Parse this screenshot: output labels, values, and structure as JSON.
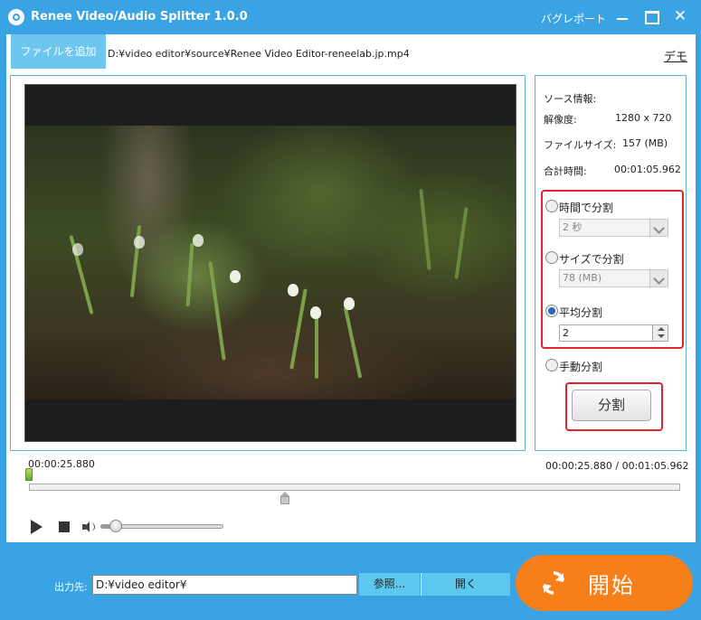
{
  "window": {
    "title": "Renee Video/Audio Splitter 1.0.0",
    "bug_report": "バグレポート",
    "close_glyph": "✕"
  },
  "toolbar": {
    "add_file": "ファイルを追加",
    "file_path": "D:¥video editor¥source¥Renee Video Editor-reneelab.jp.mp4",
    "demo": "デモ"
  },
  "source_info": {
    "header": "ソース情報:",
    "resolution_label": "解像度:",
    "resolution_value": "1280 x 720",
    "filesize_label": "ファイルサイズ:",
    "filesize_value": "157 (MB)",
    "duration_label": "合計時間:",
    "duration_value": "00:01:05.962"
  },
  "split_options": {
    "by_time_label": "時間で分割",
    "by_time_value": "2 秒",
    "by_size_label": "サイズで分割",
    "by_size_value": "78 (MB)",
    "even_label": "平均分割",
    "even_value": "2",
    "manual_label": "手動分割",
    "selected": "even"
  },
  "split_button": "分割",
  "timeline": {
    "current_time": "00:00:25.880",
    "position_display": "00:00:25.880 / 00:01:05.962",
    "progress": 0.3924
  },
  "volume": {
    "level": 0.1
  },
  "footer": {
    "output_label": "出力先:",
    "output_path": "D:¥video editor¥",
    "browse": "参照...",
    "open": "開く",
    "start": "開始"
  },
  "colors": {
    "accent_blue": "#3aa3e3",
    "button_blue": "#5cc8ef",
    "start_orange": "#f77f19",
    "highlight_red": "#e0242b",
    "radio_selected": "#2e66c8"
  },
  "icons": {
    "app": "film-reel-icon",
    "start": "refresh-arrows-icon",
    "play": "play-icon",
    "stop": "stop-icon",
    "volume": "speaker-icon"
  }
}
